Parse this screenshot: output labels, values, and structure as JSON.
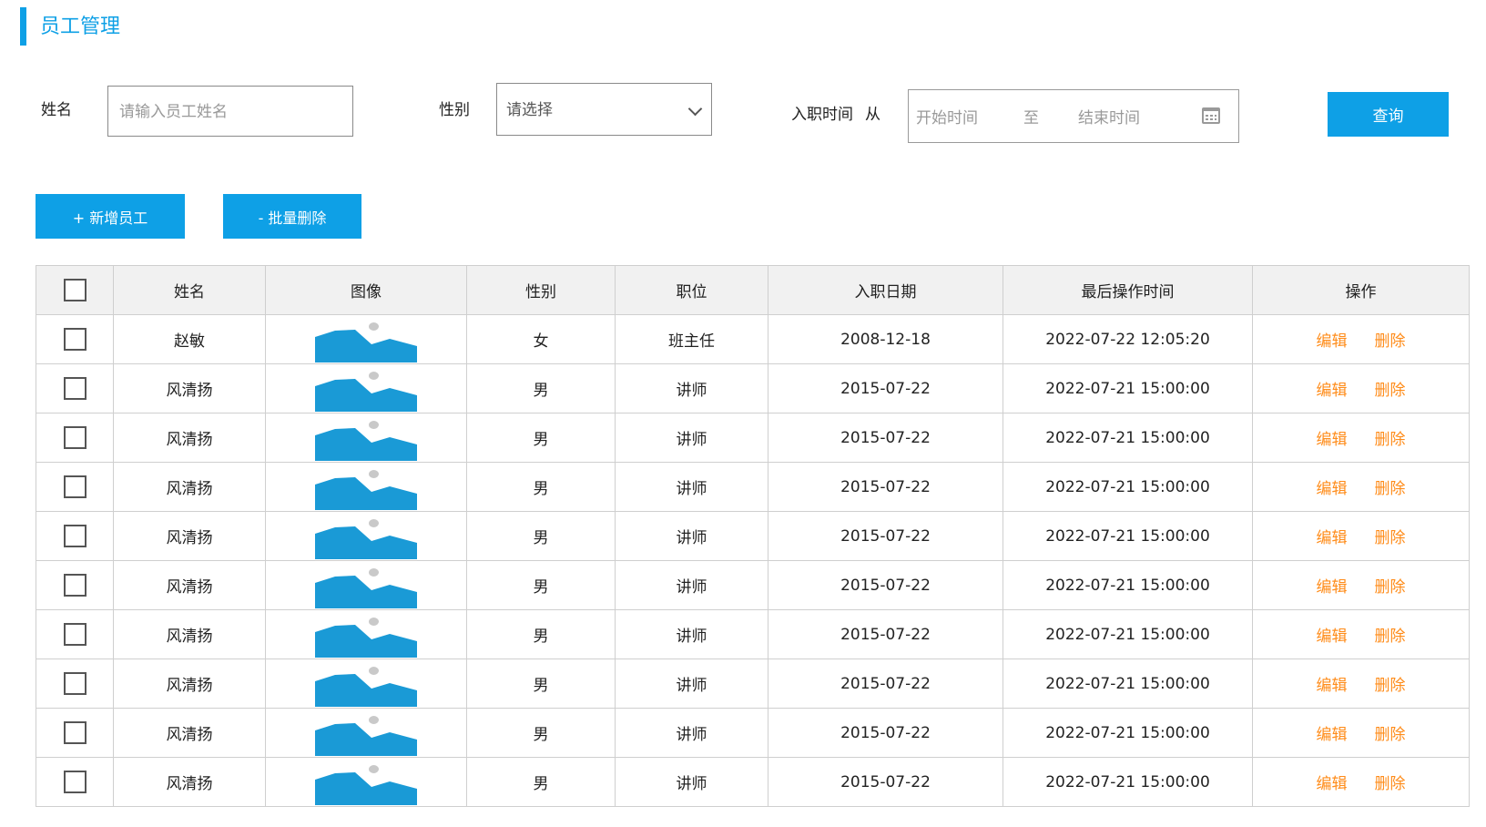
{
  "page": {
    "title": "员工管理"
  },
  "search": {
    "name_label": "姓名",
    "name_placeholder": "请输入员工姓名",
    "gender_label": "性别",
    "gender_selected": "请选择",
    "hire_label": "入职时间",
    "hire_from": "从",
    "start_placeholder": "开始时间",
    "separator": "至",
    "end_placeholder": "结束时间",
    "query_button": "查询"
  },
  "toolbar": {
    "add_label": "+ 新增员工",
    "batch_delete_label": "- 批量删除"
  },
  "table": {
    "headers": [
      "姓名",
      "图像",
      "性别",
      "职位",
      "入职日期",
      "最后操作时间",
      "操作"
    ],
    "action_edit": "编辑",
    "action_delete": "删除",
    "rows": [
      {
        "name": "赵敏",
        "gender": "女",
        "position": "班主任",
        "hire_date": "2008-12-18",
        "last_op": "2022-07-22 12:05:20"
      },
      {
        "name": "风清扬",
        "gender": "男",
        "position": "讲师",
        "hire_date": "2015-07-22",
        "last_op": "2022-07-21 15:00:00"
      },
      {
        "name": "风清扬",
        "gender": "男",
        "position": "讲师",
        "hire_date": "2015-07-22",
        "last_op": "2022-07-21 15:00:00"
      },
      {
        "name": "风清扬",
        "gender": "男",
        "position": "讲师",
        "hire_date": "2015-07-22",
        "last_op": "2022-07-21 15:00:00"
      },
      {
        "name": "风清扬",
        "gender": "男",
        "position": "讲师",
        "hire_date": "2015-07-22",
        "last_op": "2022-07-21 15:00:00"
      },
      {
        "name": "风清扬",
        "gender": "男",
        "position": "讲师",
        "hire_date": "2015-07-22",
        "last_op": "2022-07-21 15:00:00"
      },
      {
        "name": "风清扬",
        "gender": "男",
        "position": "讲师",
        "hire_date": "2015-07-22",
        "last_op": "2022-07-21 15:00:00"
      },
      {
        "name": "风清扬",
        "gender": "男",
        "position": "讲师",
        "hire_date": "2015-07-22",
        "last_op": "2022-07-21 15:00:00"
      },
      {
        "name": "风清扬",
        "gender": "男",
        "position": "讲师",
        "hire_date": "2015-07-22",
        "last_op": "2022-07-21 15:00:00"
      },
      {
        "name": "风清扬",
        "gender": "男",
        "position": "讲师",
        "hire_date": "2015-07-22",
        "last_op": "2022-07-21 15:00:00"
      }
    ]
  },
  "colors": {
    "accent": "#0ea0e6",
    "link": "#ff8c1a",
    "header_bg": "#f1f1f1",
    "image_placeholder": "#1a9ad6"
  },
  "icons": {
    "calendar": "calendar-icon",
    "dropdown": "chevron-down-icon",
    "image": "image-placeholder-icon"
  }
}
